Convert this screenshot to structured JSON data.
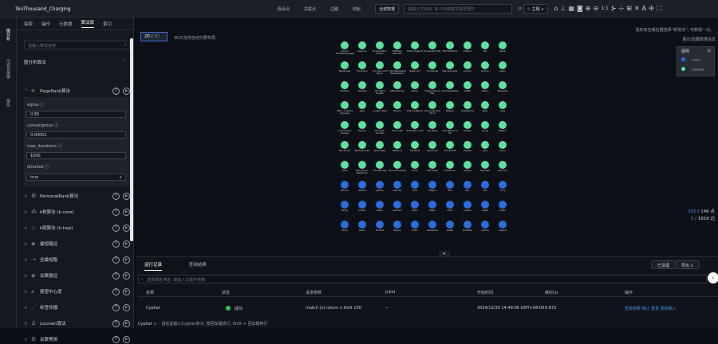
{
  "app": {
    "title": "TenThousand_Charging"
  },
  "toolbar": {
    "items": [
      "假设点",
      "关联点",
      "边路",
      "收起"
    ],
    "select_value": "全部数据",
    "search_placeholder": "请输入节点ID, 多个ID用英文逗号隔开",
    "theme": "主题",
    "zoom_label": "1:1"
  },
  "rail": {
    "items": [
      "图分析",
      "可视化建模",
      "报告"
    ]
  },
  "sidebar": {
    "tabs": [
      "探索",
      "操作",
      "元数据",
      "算法库",
      "索引"
    ],
    "active_tab": "算法库",
    "search_placeholder": "请输入算法名称",
    "group_label": "图分析算法",
    "pagerank": "PageRank算法",
    "params": [
      {
        "label": "alpha",
        "value": "0.85"
      },
      {
        "label": "convergence",
        "value": "0.00001"
      },
      {
        "label": "max_iterations",
        "value": "1000"
      },
      {
        "label": "directed",
        "value": "true"
      }
    ],
    "algos": [
      "PersonalRank算法",
      "k核算法 (k-core)",
      "k跳算法 (k-hop)",
      "最短路径",
      "全最短路",
      "关联路径",
      "紧密中心度",
      "标签传播",
      "Louvain算法",
      "关联预测"
    ]
  },
  "canvas": {
    "toggle_on": "2D",
    "toggle_off": "3D",
    "hint": "3D只支持自动分群布局",
    "right_hint_1": "鼠标双击或右键选择“新增点”, 可新增一点。",
    "right_hint_2": "展示/隐藏数据信息",
    "legend_title": "图例",
    "legend_items": [
      {
        "label": "user",
        "color": "#2b6ce0"
      },
      {
        "label": "movie",
        "color": "#5be29e"
      }
    ],
    "stats_nodes": "100",
    "stats_nodes_total": "146 点",
    "stats_edges": "0",
    "stats_edges_total": "1659 边"
  },
  "nodes": [
    [
      "Arnold Schwarzenegger",
      "Jayanne",
      "Brooke Eden (Actor)",
      "Marthell Freeman",
      "Duke (Ireland)",
      "Roosevelt Tyler",
      "Wolf Williams",
      "Miguel",
      "Sal",
      "Jamal"
    ],
    [
      "Paulbrows",
      "Francisco",
      "The Sound of Music",
      "The Shawshank Redemption",
      "Sister Act",
      "Christmas",
      "Dancing Girls",
      "Lincoln",
      "Sicario",
      "Swan"
    ],
    [
      "Bradley",
      "Chelsea",
      "The Dark Knight",
      "Little Women",
      "Rocky",
      "Independence Day",
      "Les Misérables",
      "Griffin",
      "Allison",
      "Margaret"
    ],
    [
      "2001: A Space Odyssey",
      "Jaws",
      "Jurassic Park",
      "Psycho",
      "The Godfather",
      "Gone with the Wind",
      "Platoon",
      "Casablanca",
      "Willy",
      "Luke"
    ],
    [
      "A Clockwork Orange",
      "Psycho",
      "The Deer Hunter",
      "Annie Hall",
      "Schindler's List",
      "Toy Story",
      "The Wizard of Oz",
      "Claude",
      "Lacey",
      "William"
    ],
    [
      "Taxi Driver",
      "Blade Runner",
      "Terminator",
      "Rebecca",
      "The Birds",
      "Superman",
      "The Patriot",
      "Hayden",
      "June",
      "Lance"
    ],
    [
      "Carlo",
      "Being John Malkovich",
      "The Shining",
      "Groundhog Day",
      "Vivian",
      "Mercedes",
      "Katherine",
      "Jeffrey",
      "Marshall",
      "Solomon"
    ],
    [
      "Bernie",
      "Serena",
      "Joshua",
      "Leander",
      "Fred",
      "Megan",
      "Ella",
      "Roy",
      "Mia",
      "Cory"
    ],
    [
      "Hardy",
      "Jordan",
      "Rahul",
      "Glendon",
      "Kevin",
      "Ethan",
      "Clark",
      "Juliana",
      "Caleb",
      "Cristo"
    ],
    [
      "Henry",
      "Gavin",
      "Donald",
      "Wayne",
      "Frank",
      "Alexander",
      "Isaiah",
      "Jonathan",
      "Joshua",
      "August"
    ]
  ],
  "bottom": {
    "tabs": [
      "运行记录",
      "查询结果"
    ],
    "active": "运行记录",
    "btn_clear": "已清理",
    "btn_export": "导出",
    "search_placeholder": "选择报告筛选, 或输入关键字搜索",
    "headers": [
      "名称",
      "状态",
      "请求参数",
      "jobId",
      "开始时间",
      "耗时(s)",
      "操作"
    ],
    "row": {
      "name": "Cypher",
      "status": "成功",
      "params": "match (n) return n limit 100",
      "jobid": "--",
      "start": "2024/12/30 14:49:06 GMT+08:00",
      "cost": "0.872",
      "actions": "查看结果  停止  重发  复制输入"
    },
    "cmd_label": "Cypher",
    "cmd_hint": "请在此输入Cypher命令, 按回车键执行, Shift + 回车键换行"
  }
}
